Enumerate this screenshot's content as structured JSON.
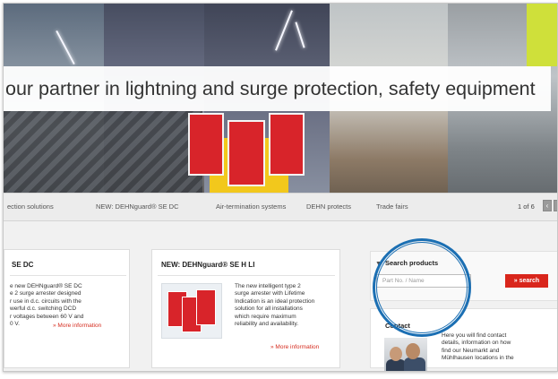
{
  "hero": {
    "tagline": "our partner in lightning and surge protection, safety equipment"
  },
  "nav": {
    "items": [
      "ection solutions",
      "NEW: DEHNguard® SE DC",
      "Air-termination systems",
      "DEHN protects",
      "Trade fairs"
    ],
    "pager": "1 of 6"
  },
  "cards": [
    {
      "title": "SE DC",
      "text": "e new DEHNguard® SE DC\ne 2 surge arrester designed\nr use in d.c. circuits with the\nwerful d.c. switching DCD\nr voltages between 60 V and\n0 V.",
      "more": "» More information"
    },
    {
      "title": "NEW: DEHNguard® SE H LI",
      "text": "The new intelligent type 2\nsurge arrester with Lifetime\nIndication is an ideal protection\nsolution for all installations\nwhich require maximum\nreliability and availability.",
      "more": "» More information"
    }
  ],
  "search": {
    "title": "Search products",
    "placeholder": "Part No. / Name",
    "button": "» search"
  },
  "contact": {
    "title": "Contact",
    "text": "Here you will find contact\ndetails, information on how\nfind our Neumarkt and\nMühlhausen locations in the"
  },
  "colors": {
    "accent": "#d9261c",
    "highlight_ring": "#1b6fb3"
  },
  "icons": {
    "search_chevron": "chevron-down-icon",
    "pager_prev": "arrow-left-icon",
    "pager_next": "arrow-right-icon"
  }
}
